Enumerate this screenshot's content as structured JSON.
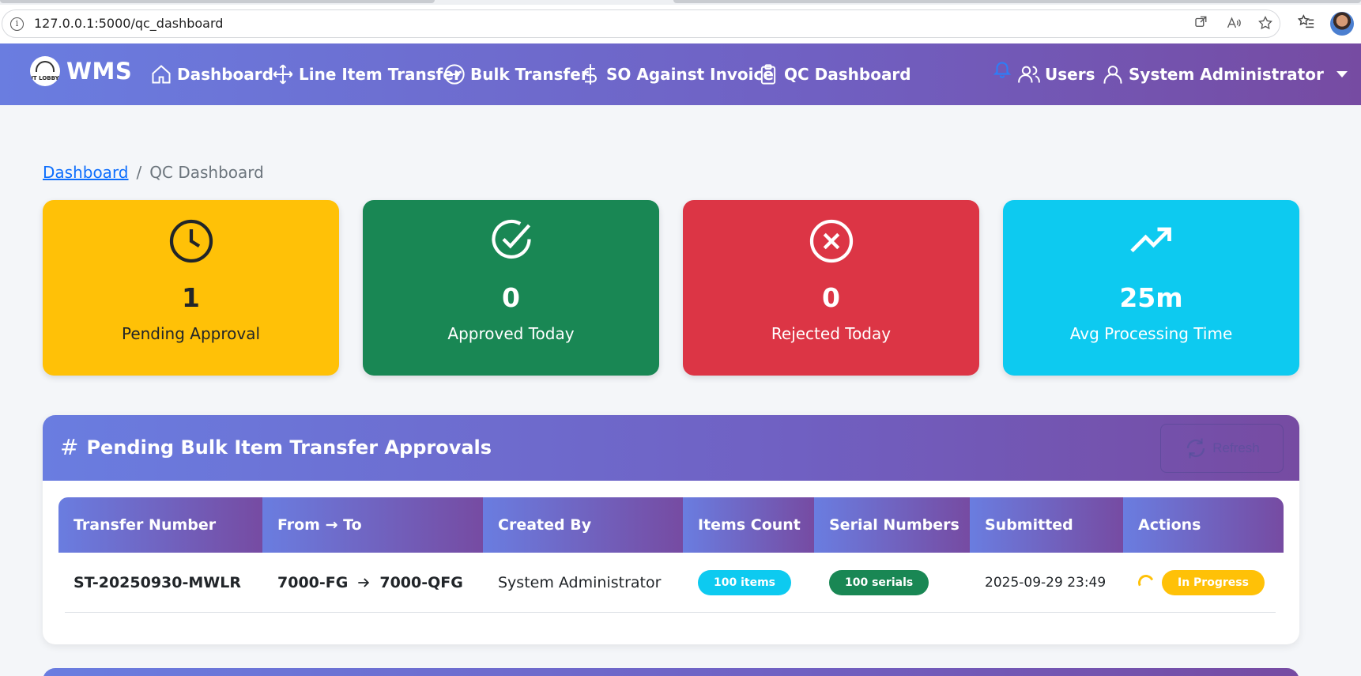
{
  "browser": {
    "url": "127.0.0.1:5000/qc_dashboard"
  },
  "navbar": {
    "brand": "WMS",
    "logo_text": "IT LOBBY",
    "items": [
      {
        "label": "Dashboard",
        "icon": "house-icon"
      },
      {
        "label": "Line Item Transfer",
        "icon": "arrows-move-icon"
      },
      {
        "label": "Bulk Transfer",
        "icon": "arrow-right-circle-icon"
      },
      {
        "label": "SO Against Invoice",
        "icon": "dollar-icon"
      },
      {
        "label": "QC Dashboard",
        "icon": "clipboard-icon"
      }
    ],
    "users_label": "Users",
    "user_name": "System Administrator"
  },
  "breadcrumb": {
    "home": "Dashboard",
    "current": "QC Dashboard"
  },
  "stats": [
    {
      "value": "1",
      "label": "Pending Approval",
      "color": "#ffc107",
      "icon": "clock-icon"
    },
    {
      "value": "0",
      "label": "Approved Today",
      "color": "#198754",
      "icon": "check-circle-icon"
    },
    {
      "value": "0",
      "label": "Rejected Today",
      "color": "#dc3545",
      "icon": "x-circle-icon"
    },
    {
      "value": "25m",
      "label": "Avg Processing Time",
      "color": "#0dcaf0",
      "icon": "trending-up-icon"
    }
  ],
  "pending_panel": {
    "title": "Pending Bulk Item Transfer Approvals",
    "refresh_label": "Refresh",
    "columns": [
      "Transfer Number",
      "From → To",
      "Created By",
      "Items Count",
      "Serial Numbers",
      "Submitted",
      "Actions"
    ],
    "rows": [
      {
        "transfer_number": "ST-20250930-MWLR",
        "from": "7000-FG",
        "to": "7000-QFG",
        "created_by": "System Administrator",
        "items_count": "100 items",
        "serial_numbers": "100 serials",
        "submitted": "2025-09-29 23:49",
        "status": "In Progress"
      }
    ]
  },
  "colors": {
    "accent_start": "#6a7de0",
    "accent_end": "#764ba2",
    "info": "#0dcaf0",
    "success": "#198754",
    "warning": "#ffc107",
    "danger": "#dc3545"
  }
}
